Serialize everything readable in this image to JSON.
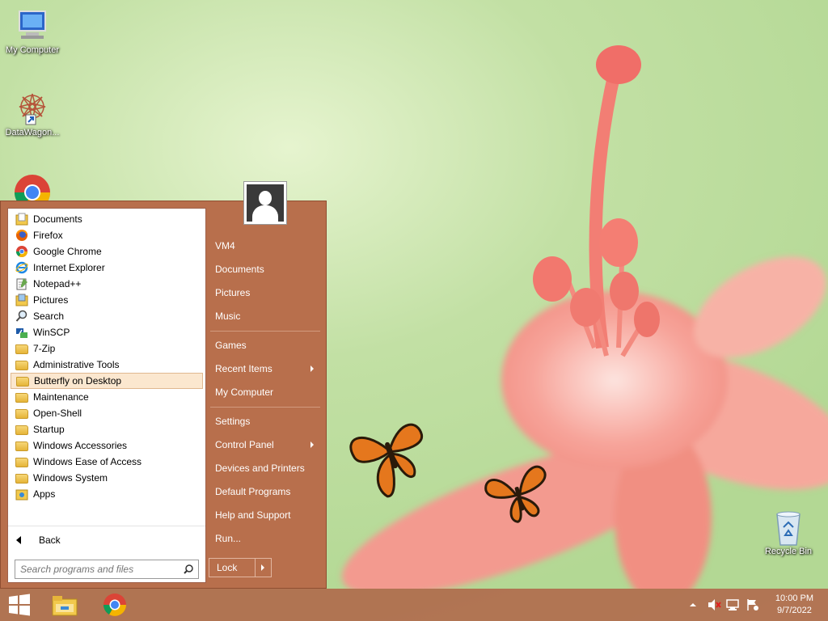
{
  "desktop": {
    "icons": [
      {
        "label": "My Computer"
      },
      {
        "label": "DataWagon..."
      },
      {
        "label": "Recycle Bin"
      }
    ]
  },
  "start_menu": {
    "programs": [
      {
        "label": "Documents",
        "icon": "documents-folder-icon"
      },
      {
        "label": "Firefox",
        "icon": "firefox-icon"
      },
      {
        "label": "Google Chrome",
        "icon": "chrome-icon"
      },
      {
        "label": "Internet Explorer",
        "icon": "internet-explorer-icon"
      },
      {
        "label": "Notepad++",
        "icon": "notepad-icon"
      },
      {
        "label": "Pictures",
        "icon": "pictures-folder-icon"
      },
      {
        "label": "Search",
        "icon": "search-icon"
      },
      {
        "label": "WinSCP",
        "icon": "winscp-icon"
      },
      {
        "label": "7-Zip",
        "icon": "folder-icon"
      },
      {
        "label": "Administrative Tools",
        "icon": "folder-icon"
      },
      {
        "label": "Butterfly on Desktop",
        "icon": "folder-icon",
        "highlighted": true
      },
      {
        "label": "Maintenance",
        "icon": "folder-icon"
      },
      {
        "label": "Open-Shell",
        "icon": "folder-icon"
      },
      {
        "label": "Startup",
        "icon": "folder-icon"
      },
      {
        "label": "Windows Accessories",
        "icon": "folder-icon"
      },
      {
        "label": "Windows Ease of Access",
        "icon": "folder-icon"
      },
      {
        "label": "Windows System",
        "icon": "folder-icon"
      },
      {
        "label": "Apps",
        "icon": "apps-icon"
      }
    ],
    "back_label": "Back",
    "search_placeholder": "Search programs and files",
    "right_items": [
      {
        "label": "VM4"
      },
      {
        "label": "Documents"
      },
      {
        "label": "Pictures"
      },
      {
        "label": "Music"
      },
      {
        "label": "Games"
      },
      {
        "label": "Recent Items",
        "submenu": true
      },
      {
        "label": "My Computer"
      },
      {
        "label": "Settings"
      },
      {
        "label": "Control Panel",
        "submenu": true
      },
      {
        "label": "Devices and Printers"
      },
      {
        "label": "Default Programs"
      },
      {
        "label": "Help and Support"
      },
      {
        "label": "Run..."
      }
    ],
    "lock_label": "Lock"
  },
  "taskbar": {
    "pinned": [
      "start-button",
      "file-explorer-icon",
      "chrome-icon"
    ],
    "clock_time": "10:00 PM",
    "clock_date": "9/7/2022"
  },
  "colors": {
    "accent": "#b86f4c",
    "highlight": "#fbe7cf"
  }
}
